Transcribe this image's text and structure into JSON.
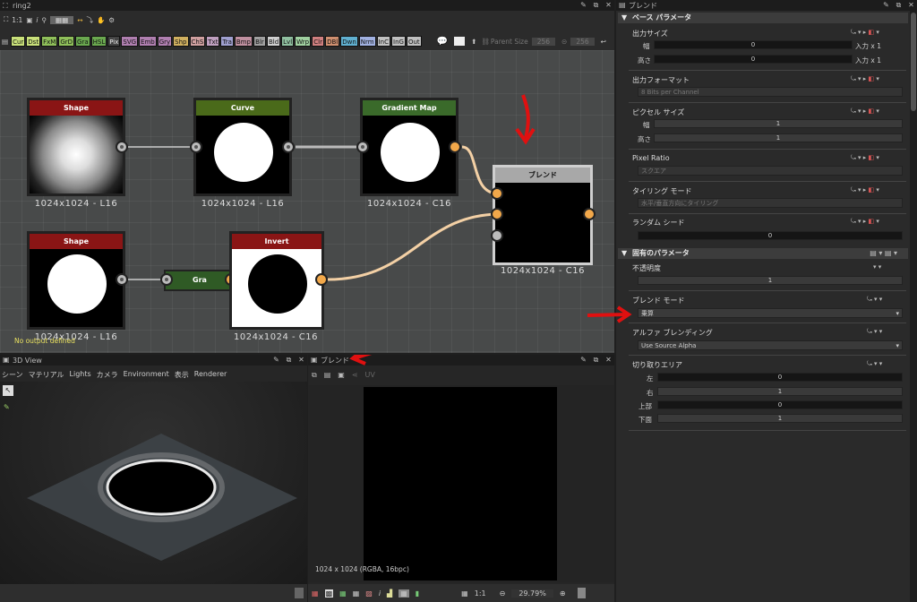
{
  "graph_window": {
    "title": "ring2",
    "toolbar1": {
      "ratio": "1:1"
    },
    "chips": [
      {
        "label": "Cur",
        "color": "#c9e07a"
      },
      {
        "label": "Dst",
        "color": "#c9e07a"
      },
      {
        "label": "FxM",
        "color": "#8fbf5a"
      },
      {
        "label": "GrD",
        "color": "#8fbf5a"
      },
      {
        "label": "Gra",
        "color": "#6aa84f"
      },
      {
        "label": "HSL",
        "color": "#6aa84f"
      },
      {
        "label": "Pix",
        "color": "#444444"
      },
      {
        "label": "SVG",
        "color": "#b07fb0"
      },
      {
        "label": "Emb",
        "color": "#b07fb0"
      },
      {
        "label": "Gry",
        "color": "#b07fb0"
      },
      {
        "label": "Shp",
        "color": "#d0b060"
      },
      {
        "label": "ChS",
        "color": "#d0a0a0"
      },
      {
        "label": "Txt",
        "color": "#c0a0c0"
      },
      {
        "label": "Tra",
        "color": "#a0a0d0"
      },
      {
        "label": "Bmp",
        "color": "#c090a0"
      },
      {
        "label": "Blr",
        "color": "#a0a0a0"
      },
      {
        "label": "Bld",
        "color": "#d0d0d0"
      },
      {
        "label": "Lvl",
        "color": "#90c0a0"
      },
      {
        "label": "Wrp",
        "color": "#a0d0a0"
      },
      {
        "label": "Clr",
        "color": "#d08080"
      },
      {
        "label": "DBl",
        "color": "#d09070"
      },
      {
        "label": "Dwn",
        "color": "#60b0d0"
      },
      {
        "label": "Nrm",
        "color": "#a0b0e0"
      },
      {
        "label": "InC",
        "color": "#c0c0c0"
      },
      {
        "label": "InG",
        "color": "#c0c0c0"
      },
      {
        "label": "Out",
        "color": "#c0c0c0"
      }
    ],
    "parent_size_label": "Parent Size",
    "parent_w": "256",
    "parent_h": "256",
    "status": "No output defined"
  },
  "nodes": {
    "shape1": {
      "title": "Shape",
      "caption": "1024x1024 - L16",
      "color": "#8a1515"
    },
    "curve": {
      "title": "Curve",
      "caption": "1024x1024 - L16",
      "color": "#4a6a1a"
    },
    "gradmap": {
      "title": "Gradient Map",
      "caption": "1024x1024 - C16",
      "color": "#3a6a2a"
    },
    "blend": {
      "title": "ブレンド",
      "caption": "1024x1024 - C16",
      "color": "#a8a8a8"
    },
    "shape2": {
      "title": "Shape",
      "caption": "1024x1024 - L16",
      "color": "#8a1515"
    },
    "gra": {
      "title": "Gra",
      "color": "#2f5a25"
    },
    "invert": {
      "title": "Invert",
      "caption": "1024x1024 - C16",
      "color": "#8a1515"
    }
  },
  "view3d": {
    "title": "3D View",
    "menu": [
      "シーン",
      "マテリアル",
      "Lights",
      "カメラ",
      "Environment",
      "表示",
      "Renderer"
    ]
  },
  "view2d": {
    "title": "ブレンド",
    "uv": "UV",
    "info": "1024 x 1024 (RGBA, 16bpc)",
    "ratio": "1:1",
    "zoom": "29.79%"
  },
  "props": {
    "title": "ブレンド",
    "base_section": "ベース パラメータ",
    "output_size": "出力サイズ",
    "width": "幅",
    "height": "高さ",
    "width_val": "0",
    "height_val": "0",
    "input_x1_a": "入力 x 1",
    "input_x1_b": "入力 x 1",
    "output_format": "出力フォーマット",
    "output_format_val": "8 Bits per Channel",
    "pixel_size": "ピクセル サイズ",
    "pixel_w": "幅",
    "pixel_h": "高さ",
    "pixel_w_val": "1",
    "pixel_h_val": "1",
    "pixel_ratio": "Pixel Ratio",
    "pixel_ratio_val": "スクエア",
    "tiling_mode": "タイリング モード",
    "tiling_val": "水平/垂直方向にタイリング",
    "random_seed": "ランダム シード",
    "random_seed_val": "0",
    "specific_section": "固有のパラメータ",
    "opacity": "不透明度",
    "opacity_val": "1",
    "blend_mode": "ブレンド モード",
    "blend_mode_val": "乗算",
    "alpha_blending": "アルファ ブレンディング",
    "alpha_blending_val": "Use Source Alpha",
    "crop_area": "切り取りエリア",
    "left": "左",
    "right": "右",
    "top": "上部",
    "bottom": "下面",
    "left_val": "0",
    "right_val": "1",
    "top_val": "0",
    "bottom_val": "1"
  }
}
